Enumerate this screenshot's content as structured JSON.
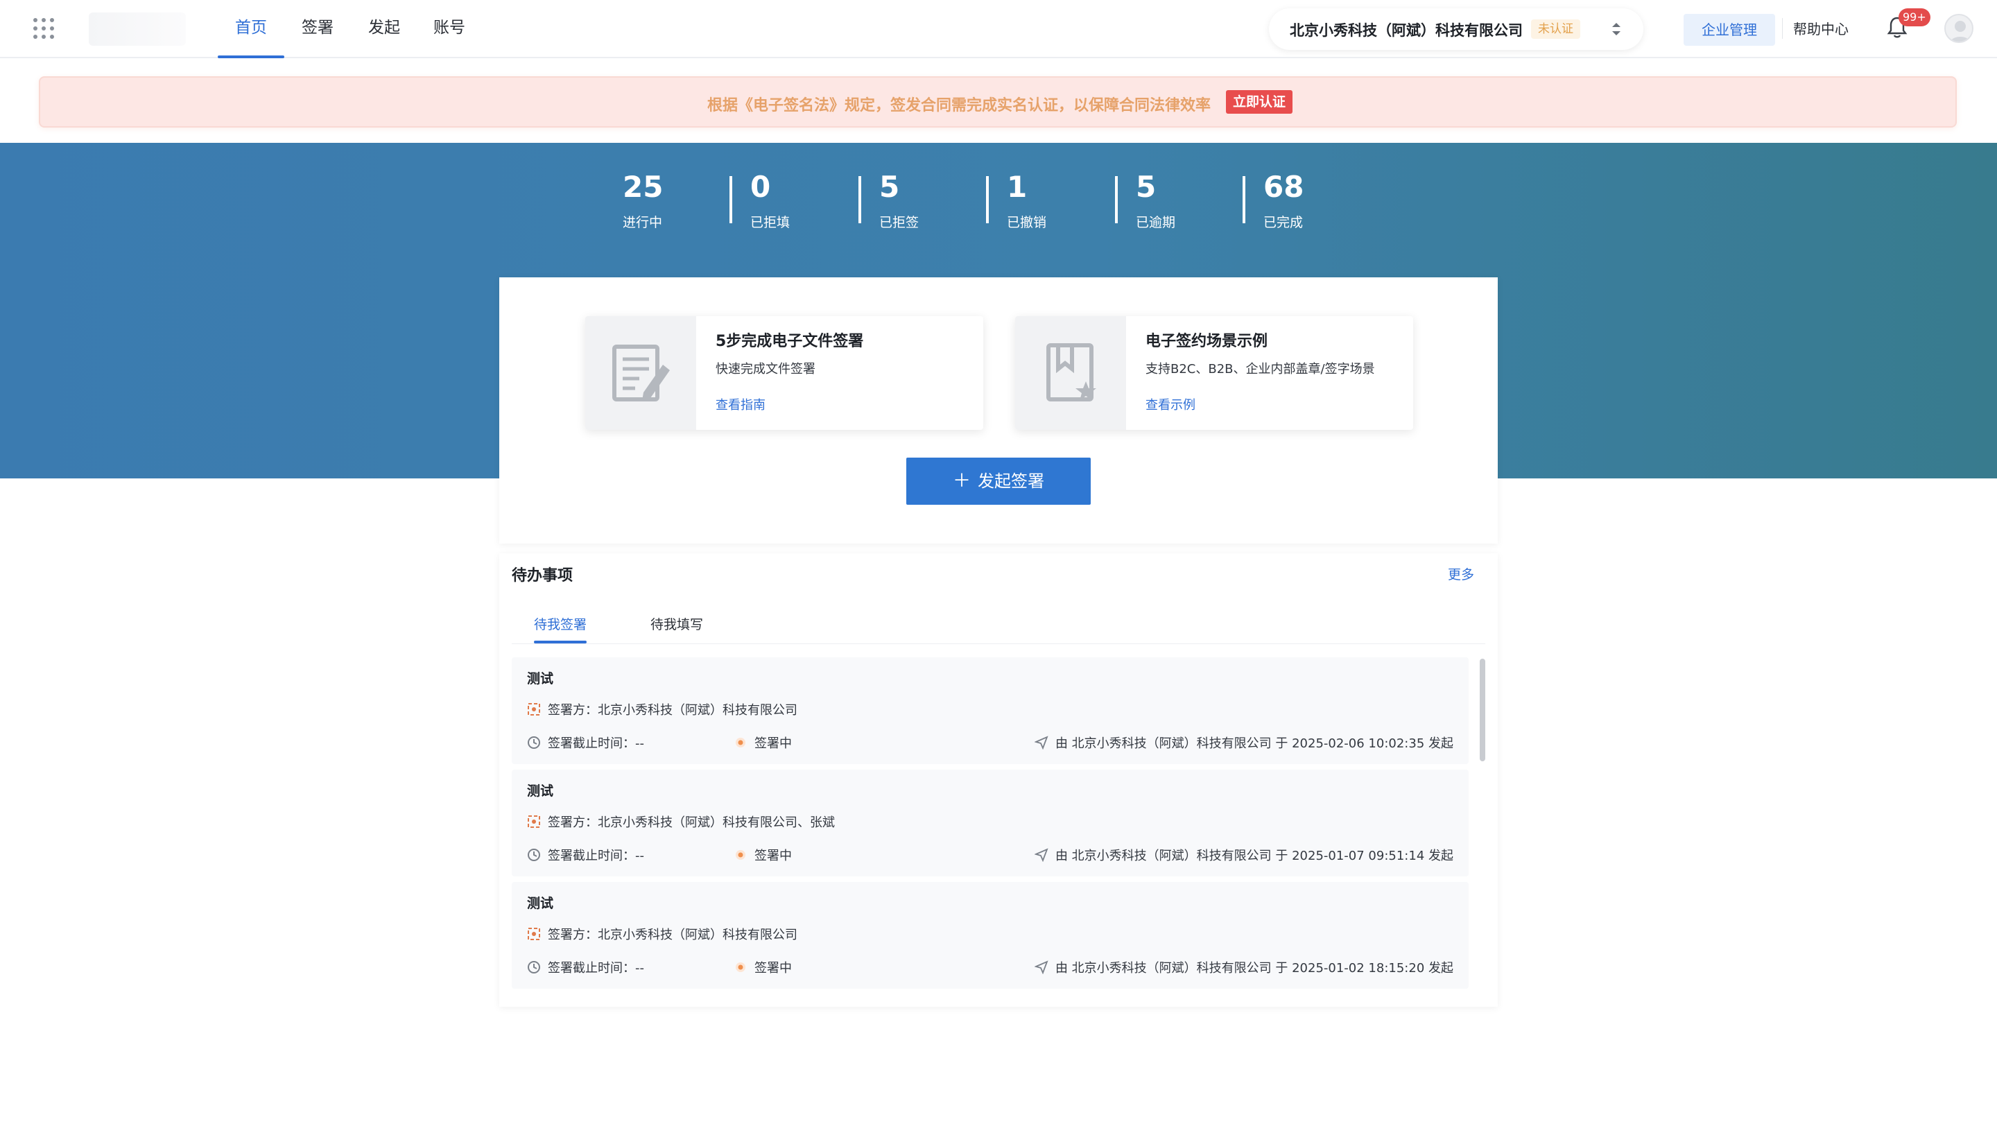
{
  "nav": {
    "tabs": [
      {
        "label": "首页",
        "active": true
      },
      {
        "label": "签署"
      },
      {
        "label": "发起"
      },
      {
        "label": "账号"
      }
    ],
    "org_name": "北京小秀科技（阿斌）科技有限公司",
    "org_status": "未认证",
    "enterprise_btn": "企业管理",
    "help": "帮助中心",
    "notif_count": "99+"
  },
  "notice": {
    "text": "根据《电子签名法》规定，签发合同需完成实名认证，以保障合同法律效率",
    "action": "立即认证"
  },
  "stats": [
    {
      "value": "25",
      "label": "进行中"
    },
    {
      "value": "0",
      "label": "已拒填"
    },
    {
      "value": "5",
      "label": "已拒签"
    },
    {
      "value": "1",
      "label": "已撤销"
    },
    {
      "value": "5",
      "label": "已逾期"
    },
    {
      "value": "68",
      "label": "已完成"
    }
  ],
  "guides": [
    {
      "title": "5步完成电子文件签署",
      "desc": "快速完成文件签署",
      "link": "查看指南",
      "icon": "document-edit-icon"
    },
    {
      "title": "电子签约场景示例",
      "desc": "支持B2C、B2B、企业内部盖章/签字场景",
      "link": "查看示例",
      "icon": "bookmark-star-icon"
    }
  ],
  "start_button": "发起签署",
  "todo": {
    "title": "待办事项",
    "more": "更多",
    "tabs": [
      "待我签署",
      "待我填写"
    ],
    "items": [
      {
        "title": "测试",
        "signers": "签署方：北京小秀科技（阿斌）科技有限公司",
        "deadline": "签署截止时间：--",
        "status": "签署中",
        "origin": "由 北京小秀科技（阿斌）科技有限公司 于 2025-02-06 10:02:35 发起"
      },
      {
        "title": "测试",
        "signers": "签署方：北京小秀科技（阿斌）科技有限公司、张斌",
        "deadline": "签署截止时间：--",
        "status": "签署中",
        "origin": "由 北京小秀科技（阿斌）科技有限公司 于 2025-01-07 09:51:14 发起"
      },
      {
        "title": "测试",
        "signers": "签署方：北京小秀科技（阿斌）科技有限公司",
        "deadline": "签署截止时间：--",
        "status": "签署中",
        "origin": "由 北京小秀科技（阿斌）科技有限公司 于 2025-01-02 18:15:20 发起"
      }
    ]
  },
  "colors": {
    "accent": "#2f6fd6",
    "banner": "#3b7bb0",
    "danger": "#e84d4d",
    "warning": "#e6a26a"
  }
}
